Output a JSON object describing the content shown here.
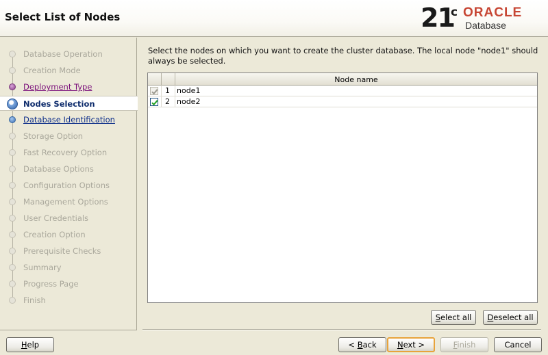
{
  "header": {
    "title": "Select List of Nodes",
    "logo": {
      "version": "21",
      "superscript": "c",
      "brand": "ORACLE",
      "product": "Database",
      "brand_color": "#c74634"
    }
  },
  "steps": [
    {
      "label": "Database Operation",
      "state": "disabled"
    },
    {
      "label": "Creation Mode",
      "state": "disabled"
    },
    {
      "label": "Deployment Type",
      "state": "visited"
    },
    {
      "label": "Nodes Selection",
      "state": "current"
    },
    {
      "label": "Database Identification",
      "state": "link"
    },
    {
      "label": "Storage Option",
      "state": "disabled"
    },
    {
      "label": "Fast Recovery Option",
      "state": "disabled"
    },
    {
      "label": "Database Options",
      "state": "disabled"
    },
    {
      "label": "Configuration Options",
      "state": "disabled"
    },
    {
      "label": "Management Options",
      "state": "disabled"
    },
    {
      "label": "User Credentials",
      "state": "disabled"
    },
    {
      "label": "Creation Option",
      "state": "disabled"
    },
    {
      "label": "Prerequisite Checks",
      "state": "disabled"
    },
    {
      "label": "Summary",
      "state": "disabled"
    },
    {
      "label": "Progress Page",
      "state": "disabled"
    },
    {
      "label": "Finish",
      "state": "disabled"
    }
  ],
  "main": {
    "instruction": "Select the nodes on which you want to create the cluster database. The local node \"node1\" should always be selected.",
    "table": {
      "columns": [
        "",
        "",
        "Node name"
      ],
      "rows": [
        {
          "index": "1",
          "name": "node1",
          "checked": true,
          "disabled": true
        },
        {
          "index": "2",
          "name": "node2",
          "checked": true,
          "disabled": false
        }
      ]
    },
    "select_all": "Select all",
    "deselect_all": "Deselect all"
  },
  "footer": {
    "help": "Help",
    "back": "< Back",
    "next": "Next >",
    "finish": "Finish",
    "cancel": "Cancel"
  }
}
